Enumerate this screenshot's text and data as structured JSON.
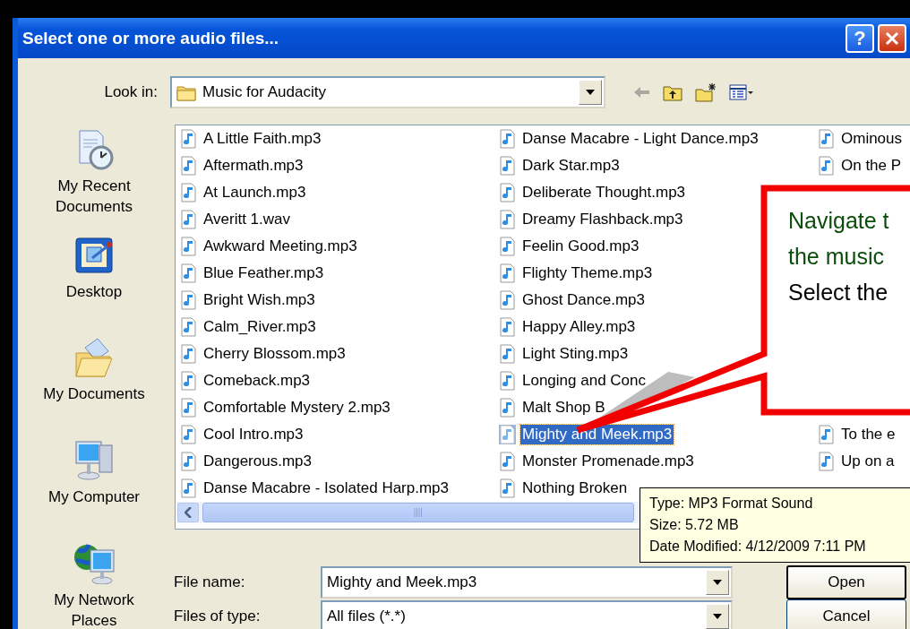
{
  "window": {
    "title": "Select one or more audio files...",
    "help_button": "?"
  },
  "look_in": {
    "label": "Look in:",
    "value": "Music for Audacity"
  },
  "places": [
    {
      "kind": "recent",
      "label": "My Recent Documents"
    },
    {
      "kind": "desktop",
      "label": "Desktop"
    },
    {
      "kind": "documents",
      "label": "My Documents"
    },
    {
      "kind": "computer",
      "label": "My Computer"
    },
    {
      "kind": "network",
      "label": "My Network Places"
    }
  ],
  "file_columns": [
    {
      "top": [
        {
          "name": "A Little Faith.mp3",
          "selected": false
        },
        {
          "name": "Aftermath.mp3",
          "selected": false
        },
        {
          "name": "At Launch.mp3",
          "selected": false
        },
        {
          "name": "Averitt 1.wav",
          "selected": false
        },
        {
          "name": "Awkward Meeting.mp3",
          "selected": false
        },
        {
          "name": "Blue Feather.mp3",
          "selected": false
        },
        {
          "name": "Bright Wish.mp3",
          "selected": false
        },
        {
          "name": "Calm_River.mp3",
          "selected": false
        },
        {
          "name": "Cherry Blossom.mp3",
          "selected": false
        },
        {
          "name": "Comeback.mp3",
          "selected": false
        },
        {
          "name": "Comfortable Mystery 2.mp3",
          "selected": false
        },
        {
          "name": "Cool Intro.mp3",
          "selected": false
        },
        {
          "name": "Dangerous.mp3",
          "selected": false
        },
        {
          "name": "Danse Macabre - Isolated Harp.mp3",
          "selected": false
        }
      ]
    },
    {
      "top": [
        {
          "name": "Danse Macabre - Light Dance.mp3",
          "selected": false
        },
        {
          "name": "Dark Star.mp3",
          "selected": false
        },
        {
          "name": "Deliberate Thought.mp3",
          "selected": false
        },
        {
          "name": "Dreamy Flashback.mp3",
          "selected": false
        },
        {
          "name": "Feelin Good.mp3",
          "selected": false
        },
        {
          "name": "Flighty Theme.mp3",
          "selected": false
        },
        {
          "name": "Ghost Dance.mp3",
          "selected": false
        },
        {
          "name": "Happy Alley.mp3",
          "selected": false
        },
        {
          "name": "Light Sting.mp3",
          "selected": false
        },
        {
          "name": "Longing and Conc",
          "selected": false
        },
        {
          "name": "Malt Shop B",
          "selected": false
        },
        {
          "name": "Mighty and Meek.mp3",
          "selected": true
        },
        {
          "name": "Monster Promenade.mp3",
          "selected": false
        },
        {
          "name": "Nothing Broken",
          "selected": false
        }
      ]
    },
    {
      "top": [
        {
          "name": "Ominous",
          "selected": false
        },
        {
          "name": "On the P",
          "selected": false
        }
      ],
      "bottom": [
        {
          "name": "To the e",
          "selected": false
        },
        {
          "name": "Up on a",
          "selected": false
        }
      ]
    }
  ],
  "file_name": {
    "label": "File name:",
    "value": "Mighty and Meek.mp3"
  },
  "file_type": {
    "label": "Files of type:",
    "value": "All files (*.*)"
  },
  "buttons": [
    "Open",
    "Cancel"
  ],
  "tooltip": [
    "Type: MP3 Format Sound",
    "Size: 5.72 MB",
    "Date Modified: 4/12/2009 7:11 PM"
  ],
  "callout": [
    {
      "text": "Navigate t",
      "color": "#0b4d0b"
    },
    {
      "text": "the music",
      "color": "#0b4d0b"
    },
    {
      "text": "Select the",
      "color": "#000000"
    }
  ]
}
